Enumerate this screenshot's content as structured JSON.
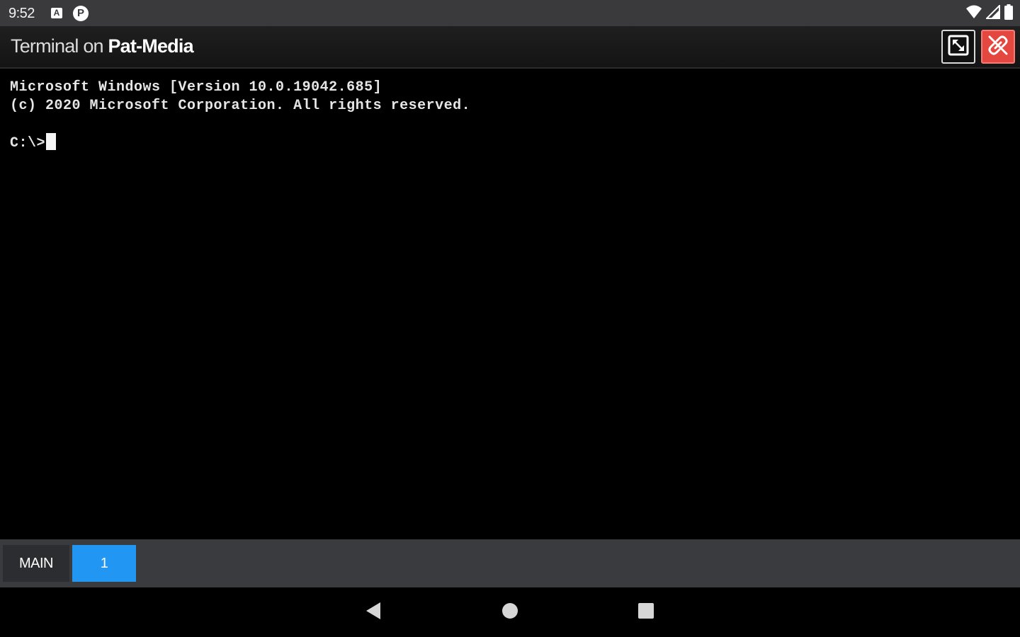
{
  "status_bar": {
    "time": "9:52",
    "notification_icons": [
      "a-badge-icon",
      "p-circle-icon"
    ],
    "notif_a_glyph": "A",
    "notif_p_glyph": "P",
    "system_icons": [
      "wifi-icon",
      "cell-signal-icon",
      "battery-icon"
    ]
  },
  "header": {
    "title_prefix": "Terminal on ",
    "host": "Pat-Media",
    "buttons": [
      "fullscreen-icon",
      "disconnect-icon"
    ],
    "colors": {
      "disconnect": "#e4473f"
    }
  },
  "terminal": {
    "lines": [
      "Microsoft Windows [Version 10.0.19042.685]",
      "(c) 2020 Microsoft Corporation. All rights reserved."
    ],
    "prompt": "C:\\>"
  },
  "tabs": {
    "items": [
      {
        "label": "MAIN",
        "active": false
      },
      {
        "label": "1",
        "active": true
      }
    ],
    "colors": {
      "active": "#2196f3"
    }
  },
  "nav": {
    "buttons": [
      "back-icon",
      "home-icon",
      "recents-icon"
    ]
  }
}
